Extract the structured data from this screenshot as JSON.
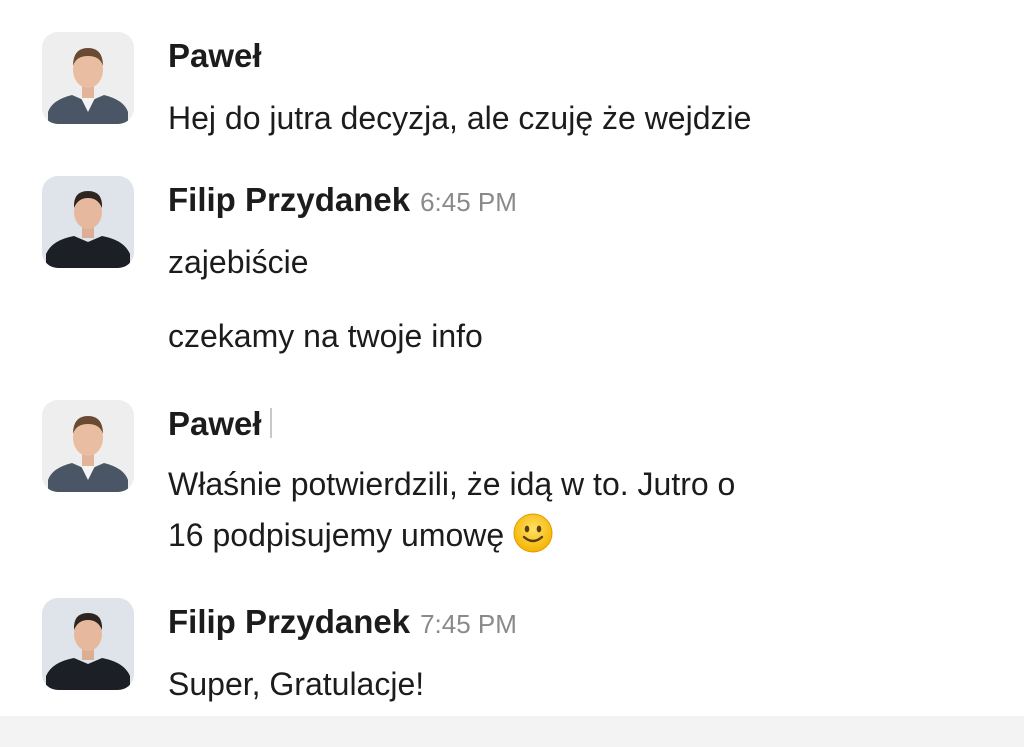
{
  "messages": [
    {
      "author": "Paweł",
      "time": "",
      "avatar_icon": "man-in-suit-portrait",
      "lines": [
        "Hej do jutra decyzja, ale czuję że wejdzie"
      ]
    },
    {
      "author": "Filip Przydanek",
      "time": "6:45 PM",
      "avatar_icon": "young-man-dark-shirt-portrait",
      "lines": [
        "zajebiście",
        "czekamy na twoje info"
      ]
    },
    {
      "author": "Paweł",
      "time": "",
      "avatar_icon": "man-in-suit-portrait",
      "lines": [
        "Właśnie potwierdzili, że idą w to. Jutro o",
        "16 podpisujemy umowę"
      ],
      "emoji_icon": "slightly-smiling-face-emoji"
    },
    {
      "author": "Filip Przydanek",
      "time": "7:45 PM",
      "avatar_icon": "young-man-dark-shirt-portrait",
      "lines": [
        "Super, Gratulacje!"
      ]
    }
  ],
  "colors": {
    "text": "#1d1c1d",
    "timestamp": "#8a8a8a",
    "background": "#ffffff"
  }
}
